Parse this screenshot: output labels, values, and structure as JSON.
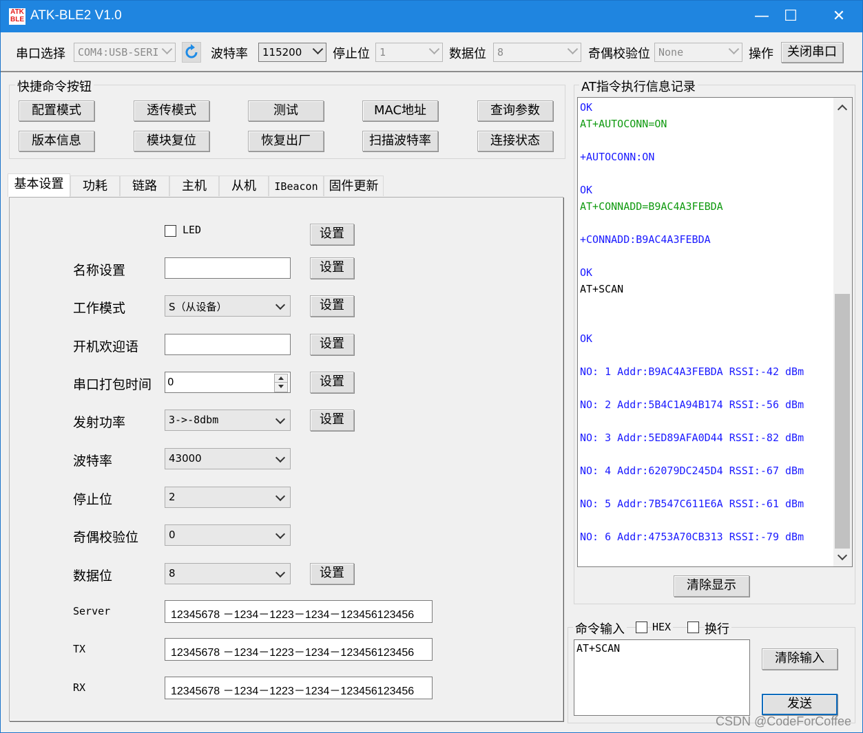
{
  "window": {
    "icon_text_top": "ATK",
    "icon_text_bottom": "BLE",
    "title": "ATK-BLE2 V1.0",
    "minimize": "—",
    "maximize": "☐",
    "close": "✕"
  },
  "toolbar": {
    "port_label": "串口选择",
    "port_value": "COM4:USB-SERI",
    "baud_label": "波特率",
    "baud_value": "115200",
    "stop_label": "停止位",
    "stop_value": "1",
    "data_label": "数据位",
    "data_value": "8",
    "parity_label": "奇偶校验位",
    "parity_value": "None",
    "op_label": "操作",
    "close_port": "关闭串口"
  },
  "quick": {
    "title": "快捷命令按钮",
    "row1": [
      "配置模式",
      "透传模式",
      "测试",
      "MAC地址",
      "查询参数"
    ],
    "row2": [
      "版本信息",
      "模块复位",
      "恢复出厂",
      "扫描波特率",
      "连接状态"
    ]
  },
  "tabs": [
    "基本设置",
    "功耗",
    "链路",
    "主机",
    "从机",
    "IBeacon",
    "固件更新"
  ],
  "basic": {
    "led_label": "LED",
    "set_label": "设置",
    "name_label": "名称设置",
    "name_value": "",
    "mode_label": "工作模式",
    "mode_value": "S（从设备）",
    "welcome_label": "开机欢迎语",
    "welcome_value": "",
    "pack_label": "串口打包时间",
    "pack_value": "0",
    "power_label": "发射功率",
    "power_value": "3->-8dbm",
    "baud_label": "波特率",
    "baud_value": "43000",
    "stop_label": "停止位",
    "stop_value": "2",
    "parity_label": "奇偶校验位",
    "parity_value": "0",
    "data_label": "数据位",
    "data_value": "8",
    "server_label": "Server",
    "server_value": "12345678 －1234－1223－1234－123456123456",
    "tx_label": "TX",
    "tx_value": "12345678 －1234－1223－1234－123456123456",
    "rx_label": "RX",
    "rx_value": "12345678 －1234－1223－1234－123456123456"
  },
  "log": {
    "title": "AT指令执行信息记录",
    "lines": [
      {
        "text": "OK",
        "color": "blue"
      },
      {
        "text": "AT+AUTOCONN=ON",
        "color": "green"
      },
      {
        "text": "",
        "color": "black"
      },
      {
        "text": "+AUTOCONN:ON",
        "color": "blue"
      },
      {
        "text": "",
        "color": "black"
      },
      {
        "text": "OK",
        "color": "blue"
      },
      {
        "text": "AT+CONNADD=B9AC4A3FEBDA",
        "color": "green"
      },
      {
        "text": "",
        "color": "black"
      },
      {
        "text": "+CONNADD:B9AC4A3FEBDA",
        "color": "blue"
      },
      {
        "text": "",
        "color": "black"
      },
      {
        "text": "OK",
        "color": "blue"
      },
      {
        "text": "AT+SCAN",
        "color": "black"
      },
      {
        "text": "",
        "color": "black"
      },
      {
        "text": "",
        "color": "black"
      },
      {
        "text": "OK",
        "color": "blue"
      },
      {
        "text": "",
        "color": "black"
      },
      {
        "text": "NO: 1 Addr:B9AC4A3FEBDA RSSI:-42 dBm",
        "color": "blue"
      },
      {
        "text": "",
        "color": "black"
      },
      {
        "text": "NO: 2 Addr:5B4C1A94B174 RSSI:-56 dBm",
        "color": "blue"
      },
      {
        "text": "",
        "color": "black"
      },
      {
        "text": "NO: 3 Addr:5ED89AFA0D44 RSSI:-82 dBm",
        "color": "blue"
      },
      {
        "text": "",
        "color": "black"
      },
      {
        "text": "NO: 4 Addr:62079DC245D4 RSSI:-67 dBm",
        "color": "blue"
      },
      {
        "text": "",
        "color": "black"
      },
      {
        "text": "NO: 5 Addr:7B547C611E6A RSSI:-61 dBm",
        "color": "blue"
      },
      {
        "text": "",
        "color": "black"
      },
      {
        "text": "NO: 6 Addr:4753A70CB313 RSSI:-79 dBm",
        "color": "blue"
      }
    ],
    "clear_display": "清除显示"
  },
  "command": {
    "title": "命令输入",
    "hex_label": "HEX",
    "newline_label": "换行",
    "input_value": "AT+SCAN",
    "clear_input": "清除输入",
    "send": "发送"
  },
  "watermark": "CSDN @CodeForCoffee"
}
